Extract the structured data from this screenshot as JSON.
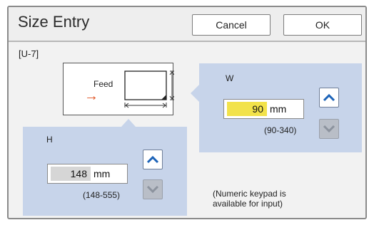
{
  "header": {
    "title": "Size Entry",
    "cancel_label": "Cancel",
    "ok_label": "OK"
  },
  "code": "[U-7]",
  "diagram": {
    "feed_label": "Feed"
  },
  "width": {
    "label": "W",
    "value": "90",
    "unit": "mm",
    "range": "(90-340)"
  },
  "height": {
    "label": "H",
    "value": "148",
    "unit": "mm",
    "range": "(148-555)"
  },
  "note": "(Numeric keypad is available for input)",
  "colors": {
    "panel": "#c7d4ea",
    "active_value": "#f2e24a",
    "inactive_value": "#d6d6d6",
    "feed_arrow": "#e0501e",
    "step_arrow": "#1c63b8"
  }
}
